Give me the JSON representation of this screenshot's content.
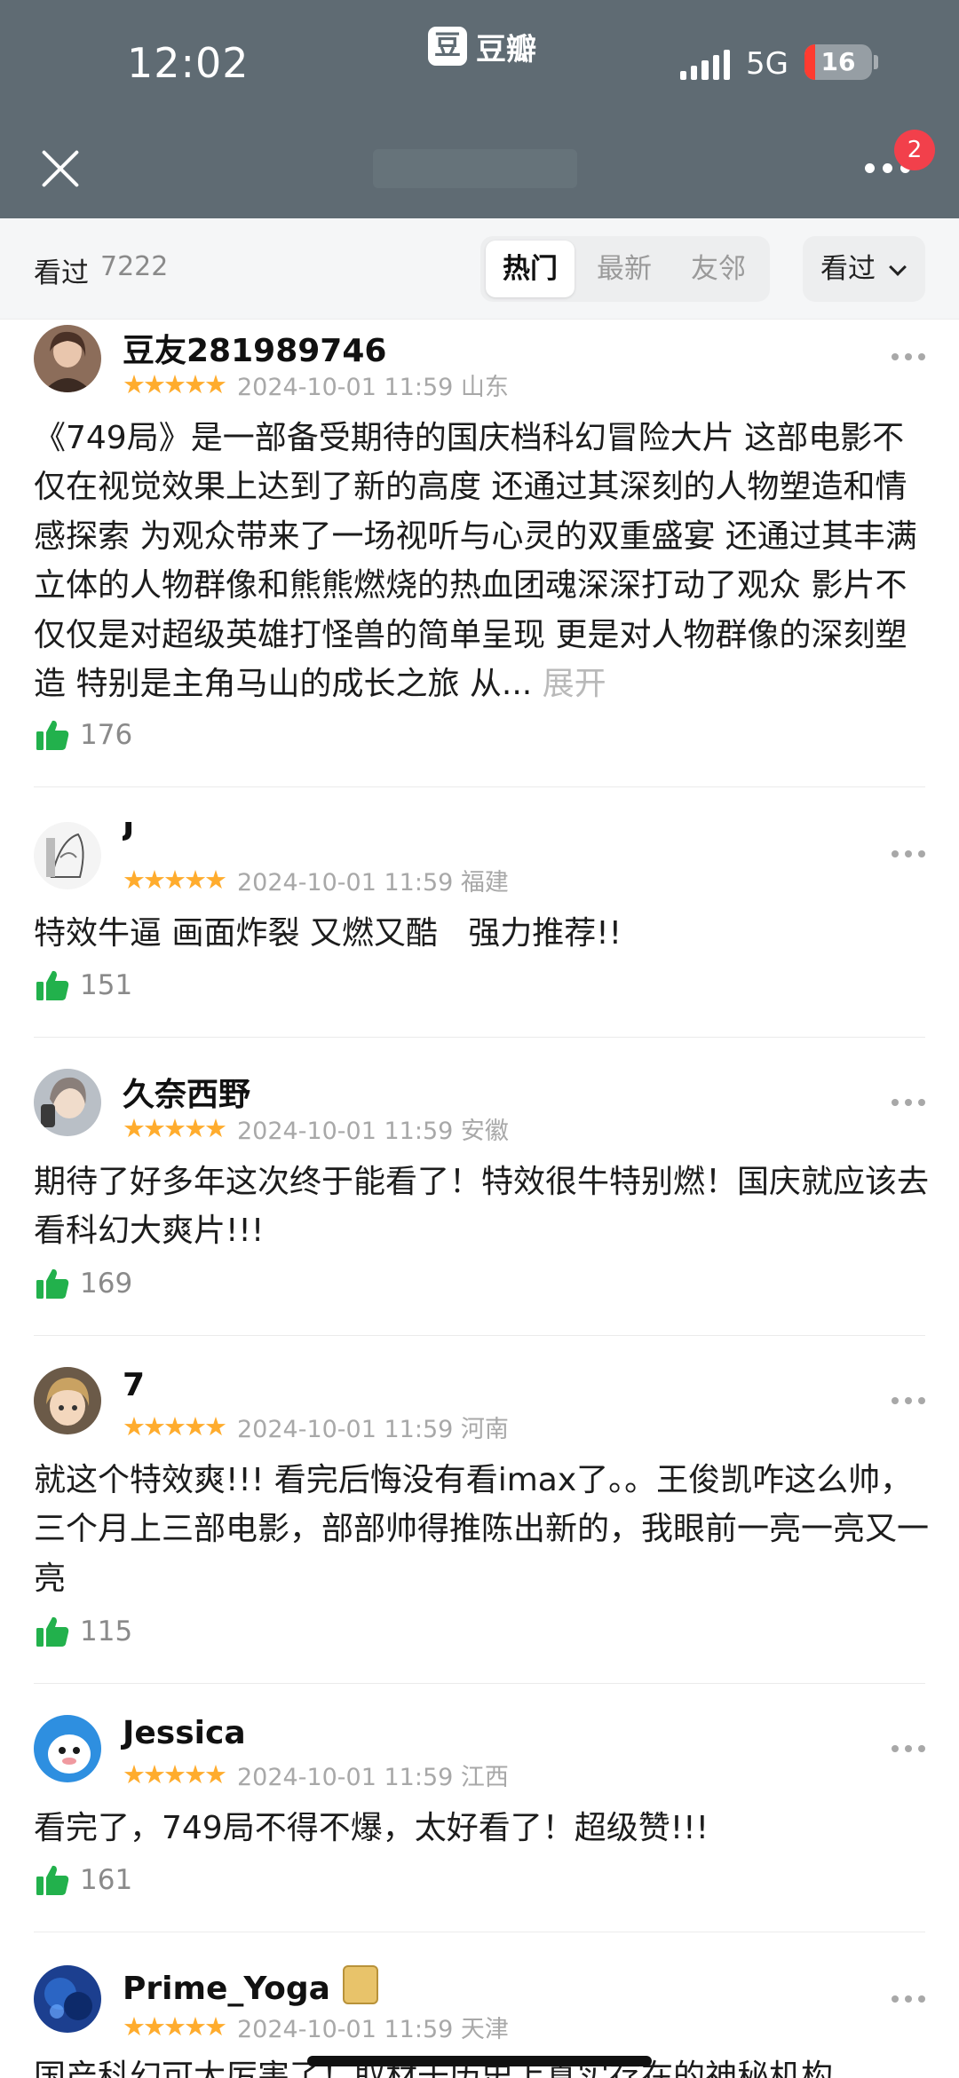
{
  "status": {
    "time": "12:02",
    "network": "5G",
    "battery": "16",
    "battery_fraction": 0.16
  },
  "app": {
    "logo_char": "豆",
    "name": "豆瓣"
  },
  "nav": {
    "notification_count": "2",
    "close_icon": "close-icon",
    "more_icon": "more-horizontal-icon"
  },
  "filter": {
    "label": "看过",
    "count": "7222",
    "tabs": [
      {
        "label": "热门",
        "active": true
      },
      {
        "label": "最新",
        "active": false
      },
      {
        "label": "友邻",
        "active": false
      }
    ],
    "sort_label": "看过"
  },
  "colors": {
    "header_bg": "#5f6b73",
    "star": "#ffac2d",
    "like": "#22b14c",
    "badge": "#f2404b"
  },
  "reviews": [
    {
      "username": "豆友281989746",
      "stars": "★★★★★",
      "meta": "2024-10-01 11:59 山东",
      "text": "《749局》是一部备受期待的国庆档科幻冒险大片 这部电影不仅在视觉效果上达到了新的高度 还通过其深刻的人物塑造和情感探索 为观众带来了一场视听与心灵的双重盛宴 还通过其丰满立体的人物群像和熊熊燃烧的热血团魂深深打动了观众 影片不仅仅是对超级英雄打怪兽的简单呈现 更是对人物群像的深刻塑造 特别是主角马山的成长之旅 从...",
      "expand": "展开",
      "likes": "176"
    },
    {
      "username": "J",
      "stars": "★★★★★",
      "meta": "2024-10-01 11:59 福建",
      "text": "特效牛逼 画面炸裂 又燃又酷   强力推荐!!",
      "likes": "151"
    },
    {
      "username": "久奈西野",
      "stars": "★★★★★",
      "meta": "2024-10-01 11:59 安徽",
      "text": "期待了好多年这次终于能看了！特效很牛特别燃！国庆就应该去看科幻大爽片!!!",
      "likes": "169"
    },
    {
      "username": "7",
      "stars": "★★★★★",
      "meta": "2024-10-01 11:59 河南",
      "text": "就这个特效爽!!! 看完后悔没有看imax了。。王俊凯咋这么帅，三个月上三部电影，部部帅得推陈出新的，我眼前一亮一亮又一亮",
      "likes": "115"
    },
    {
      "username": "Jessica",
      "stars": "★★★★★",
      "meta": "2024-10-01 11:59 江西",
      "text": "看完了，749局不得不爆，太好看了！超级赞!!!",
      "likes": "161"
    },
    {
      "username": "Prime_Yoga",
      "stars": "★★★★★",
      "meta": "2024-10-01 11:59 天津",
      "text": "国产科幻可太厉害了！取材于历史上真实存在的神秘机构"
    }
  ]
}
